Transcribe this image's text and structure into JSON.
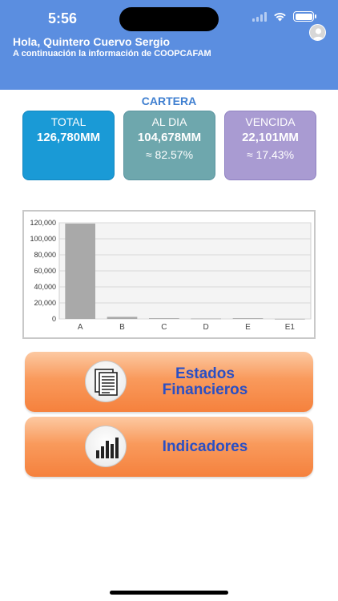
{
  "status_bar": {
    "time": "5:56"
  },
  "header": {
    "greeting": "Hola, Quintero Cuervo Sergio",
    "subtitle": "A continuación la información de COOPCAFAM",
    "avatar_icon": "user-avatar-icon"
  },
  "cartera": {
    "title": "CARTERA",
    "cards": [
      {
        "label": "TOTAL",
        "value": "126,780MM",
        "percent": "",
        "color": "#1a9ad6"
      },
      {
        "label": "AL DIA",
        "value": "104,678MM",
        "percent": "≈ 82.57%",
        "color": "#6ea7ad"
      },
      {
        "label": "VENCIDA",
        "value": "22,101MM",
        "percent": "≈ 17.43%",
        "color": "#a99bd2"
      }
    ]
  },
  "chart_data": {
    "type": "bar",
    "categories": [
      "A",
      "B",
      "C",
      "D",
      "E",
      "E1"
    ],
    "values": [
      119000,
      2600,
      900,
      500,
      900,
      150
    ],
    "yticks": [
      "0",
      "20,000",
      "40,000",
      "60,000",
      "80,000",
      "100,000",
      "120,000"
    ],
    "ylim": [
      0,
      120000
    ],
    "grid": true,
    "bar_color": "#a9a9a9",
    "title": "",
    "xlabel": "",
    "ylabel": ""
  },
  "buttons": {
    "estados": {
      "line1": "Estados",
      "line2": "Financieros",
      "icon": "document-icon"
    },
    "indicadores": {
      "label": "Indicadores",
      "icon": "bar-chart-icon"
    }
  },
  "colors": {
    "header": "#5b8ee0",
    "accent_text": "#3f7fd0",
    "button_text": "#2a4fc4",
    "button_orange": "#f5813d"
  }
}
